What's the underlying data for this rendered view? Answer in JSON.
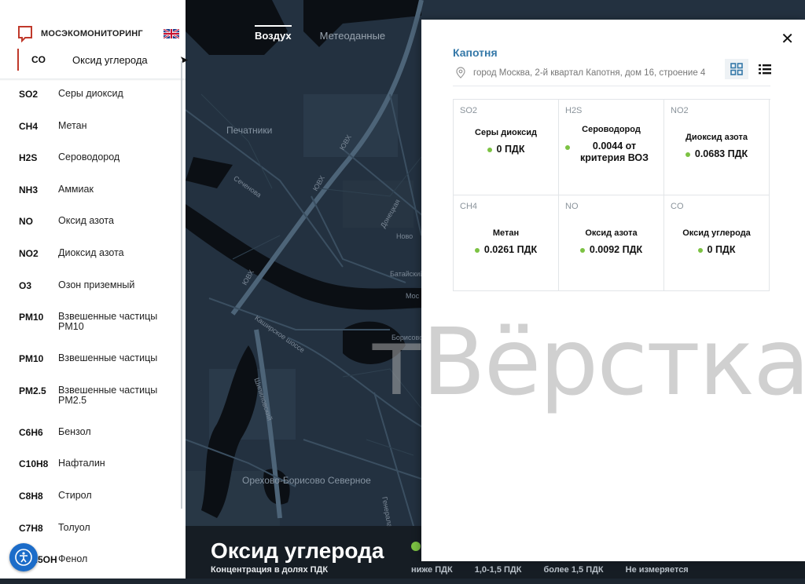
{
  "sidebar": {
    "brand": "МОСЭКОМОНИТОРИНГ",
    "selected": {
      "code": "CO",
      "name": "Оксид углерода"
    },
    "items": [
      {
        "code": "SO2",
        "name": "Серы диоксид"
      },
      {
        "code": "CH4",
        "name": "Метан"
      },
      {
        "code": "H2S",
        "name": "Сероводород"
      },
      {
        "code": "NH3",
        "name": "Аммиак"
      },
      {
        "code": "NO",
        "name": "Оксид азота"
      },
      {
        "code": "NO2",
        "name": "Диоксид азота"
      },
      {
        "code": "O3",
        "name": "Озон приземный"
      },
      {
        "code": "PM10",
        "name": "Взвешенные частицы PM10"
      },
      {
        "code": "PM10",
        "name": "Взвешенные частицы"
      },
      {
        "code": "PM2.5",
        "name": "Взвешенные частицы PM2.5"
      },
      {
        "code": "C6H6",
        "name": "Бензол"
      },
      {
        "code": "C10H8",
        "name": "Нафталин"
      },
      {
        "code": "C8H8",
        "name": "Стирол"
      },
      {
        "code": "C7H8",
        "name": "Толуол"
      },
      {
        "code": "C6H5OH",
        "name": "Фенол"
      }
    ]
  },
  "map": {
    "tabs": [
      "Воздух",
      "Метеоданные"
    ],
    "labels": {
      "pechatniki": "Печатники",
      "sechenova": "Сеченова",
      "yuvkh1": "ЮВХ",
      "yuvkh2": "ЮВХ",
      "yuvkh3": "ЮВХ",
      "donetskaya": "Донецкая",
      "novo": "Ново",
      "bataiskiy": "Батайский",
      "mos": "Мос",
      "kashirskoe": "Каширское шоссе",
      "borisovo": "Борисово",
      "shipilovsky": "Шипиловский",
      "orekhovo": "Орехово-Борисово Северное",
      "generala": "Генерала"
    },
    "legend": {
      "title": "Оксид углерода",
      "subtitle": "Концентрация в долях ПДК",
      "items": [
        "ниже ПДК",
        "1,0-1,5 ПДК",
        "более 1,5 ПДК",
        "Не измеряется"
      ]
    }
  },
  "station": {
    "name": "Капотня",
    "address": "город Москва, 2-й квартал Капотня, дом 16, строение 4",
    "cards": [
      {
        "code": "SO2",
        "name": "Серы диоксид",
        "value": "0 ПДК"
      },
      {
        "code": "H2S",
        "name": "Сероводород",
        "value": "0.0044 от критерия ВОЗ"
      },
      {
        "code": "NO2",
        "name": "Диоксид азота",
        "value": "0.0683 ПДК"
      },
      {
        "code": "CH4",
        "name": "Метан",
        "value": "0.0261 ПДК"
      },
      {
        "code": "NO",
        "name": "Оксид азота",
        "value": "0.0092 ПДК"
      },
      {
        "code": "CO",
        "name": "Оксид углерода",
        "value": "0 ПДК"
      }
    ]
  },
  "watermark": "тВёрстка",
  "colors": {
    "accent_blue": "#3478a8",
    "ok_green": "#7cc243",
    "brand_red": "#c0392b",
    "map_bg": "#232f3b",
    "river": "#0b0f14",
    "a11y_blue": "#1b6cc9"
  }
}
